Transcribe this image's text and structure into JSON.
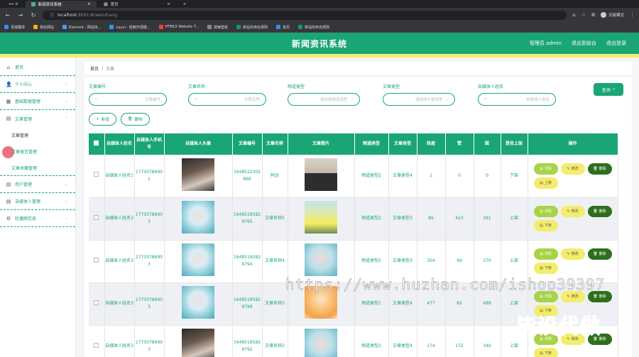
{
  "browser": {
    "tabs": [
      "新闻资讯系统",
      "首页"
    ],
    "url_host": "localhost",
    "url_port": ":8081/#/wenzhang",
    "profile": "无痕模式",
    "bookmarks": [
      "百度翻译",
      "易玩网站",
      "Element - 网站快...",
      "Layui - 经典开源模...",
      "HTML5 Website T...",
      "搜索壁纸",
      "新站的命名规则",
      "首页",
      "新站的命名规则"
    ]
  },
  "app": {
    "title": "新闻资讯系统",
    "user": "管理员 admin",
    "back": "退出到前台",
    "logout": "退出登录"
  },
  "sidebar": {
    "items": [
      {
        "label": "首页",
        "icon": "⌂"
      },
      {
        "label": "个人中心",
        "icon": "👤"
      },
      {
        "label": "基础数据管理",
        "icon": "▦"
      },
      {
        "label": "文章管理",
        "icon": "▤"
      }
    ],
    "sub": [
      "文章管理",
      "文章留言管理",
      "文章收藏管理"
    ],
    "items2": [
      {
        "label": "用户管理",
        "icon": "▤"
      },
      {
        "label": "自媒体人管理",
        "icon": "▤"
      },
      {
        "label": "轮播图信息",
        "icon": "⚙"
      }
    ]
  },
  "breadcrumb": {
    "home": "首页",
    "sep": "/",
    "current": "文章"
  },
  "filters": [
    {
      "label": "文章编号",
      "placeholder": "文章编号"
    },
    {
      "label": "文章名称",
      "placeholder": "文章名称"
    },
    {
      "label": "频道类型",
      "placeholder": "请选择频道类型"
    },
    {
      "label": "文章类型",
      "placeholder": "请选择文章类型"
    },
    {
      "label": "自媒体人姓名",
      "placeholder": "自媒体人姓名"
    }
  ],
  "query": "查询",
  "add": "新增",
  "delete": "删除",
  "columns": [
    "自媒体人姓名",
    "自媒体人手机号",
    "自媒体人头像",
    "文章编号",
    "文章名称",
    "文章照片",
    "频道类型",
    "文章类型",
    "热度",
    "赞",
    "踩",
    "是否上架",
    "操作"
  ],
  "ops": {
    "detail": "详情",
    "edit": "修改",
    "del": "删除",
    "up": "上架",
    "down": "下架"
  },
  "rows": [
    {
      "name": "自媒体人姓名1",
      "phone": "17703786901",
      "avatar": "avatar-a",
      "no": "1648522302869",
      "title": "阿达",
      "photo": "photo-a",
      "channel": "频道类型2",
      "type": "文章类型4",
      "hot": "1",
      "like": "0",
      "dislike": "0",
      "status": "下架",
      "third": "up"
    },
    {
      "name": "自媒体人姓名3",
      "phone": "17703786903",
      "avatar": "avatar-b",
      "no": "16485195829795",
      "title": "文章名称5",
      "photo": "photo-b",
      "channel": "频道类型2",
      "type": "文章类型3",
      "hot": "86",
      "like": "423",
      "dislike": "391",
      "status": "上架",
      "third": "down"
    },
    {
      "name": "自媒体人姓名3",
      "phone": "17703786903",
      "avatar": "avatar-b",
      "no": "16485195829794",
      "title": "文章名称4",
      "photo": "photo-c",
      "channel": "频道类型2",
      "type": "文章类型3",
      "hot": "304",
      "like": "99",
      "dislike": "370",
      "status": "上架",
      "third": "down"
    },
    {
      "name": "自媒体人姓名3",
      "phone": "17703786903",
      "avatar": "avatar-b",
      "no": "16485195829799",
      "title": "文章名称3",
      "photo": "photo-d",
      "channel": "频道类型1",
      "type": "文章类型4",
      "hot": "477",
      "like": "85",
      "dislike": "489",
      "status": "上架",
      "third": "down"
    },
    {
      "name": "自媒体人姓名3",
      "phone": "17703786903",
      "avatar": "avatar-a",
      "no": "16485195829792",
      "title": "文章名称2",
      "photo": "photo-c",
      "channel": "频道类型2",
      "type": "文章类型4",
      "hot": "174",
      "like": "172",
      "dislike": "340",
      "status": "上架",
      "third": "down"
    }
  ],
  "watermark": "https://www.huzhan.com/ishop39397",
  "watermark2": "毕设代做"
}
